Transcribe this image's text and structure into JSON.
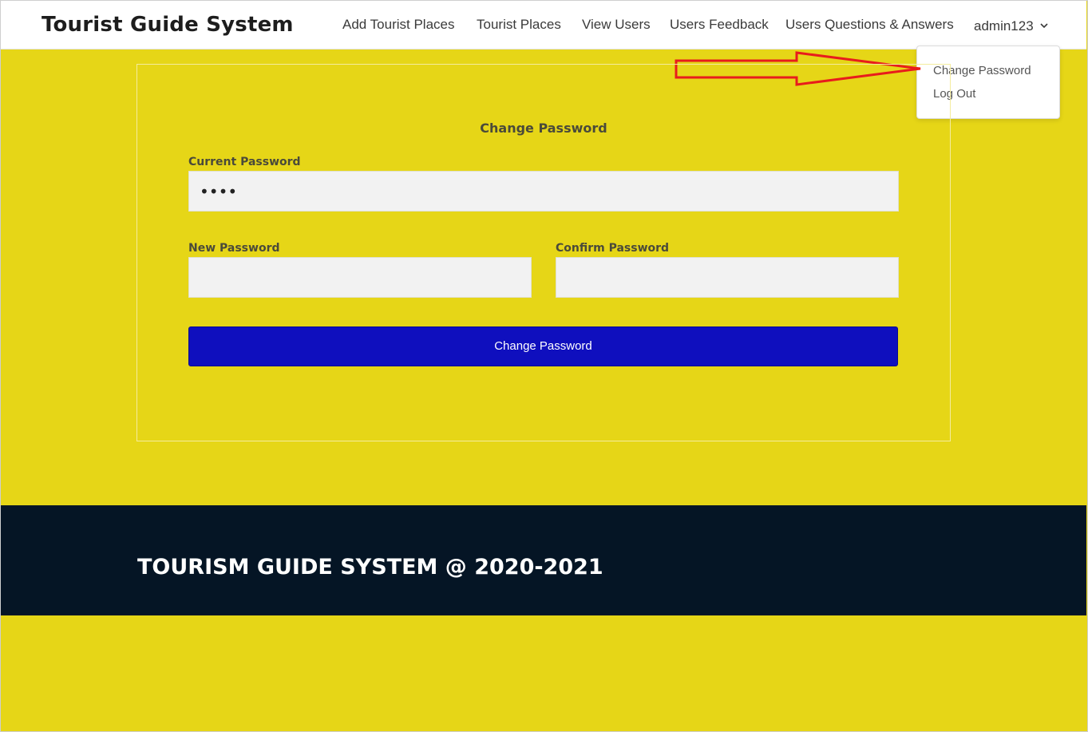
{
  "navbar": {
    "brand": "Tourist Guide System",
    "items": [
      {
        "label": "Add Tourist Places"
      },
      {
        "label": "Tourist Places"
      },
      {
        "label": "View Users"
      },
      {
        "label": "Users Feedback"
      },
      {
        "label": "Users Questions & Answers"
      }
    ],
    "user": {
      "label": "admin123",
      "icon": "chevron-down-icon"
    }
  },
  "dropdown": {
    "items": [
      {
        "label": "Change Password"
      },
      {
        "label": "Log Out"
      }
    ]
  },
  "form": {
    "title": "Change Password",
    "current_password": {
      "label": "Current Password",
      "value": "••••"
    },
    "new_password": {
      "label": "New Password",
      "value": ""
    },
    "confirm_password": {
      "label": "Confirm Password",
      "value": ""
    },
    "submit_label": "Change Password"
  },
  "footer": {
    "text": "TOURISM GUIDE SYSTEM @ 2020-2021"
  },
  "colors": {
    "page_background": "#e6d617",
    "button": "#0f0fbe",
    "footer": "#051525",
    "annotation_arrow": "#e81c1c"
  }
}
